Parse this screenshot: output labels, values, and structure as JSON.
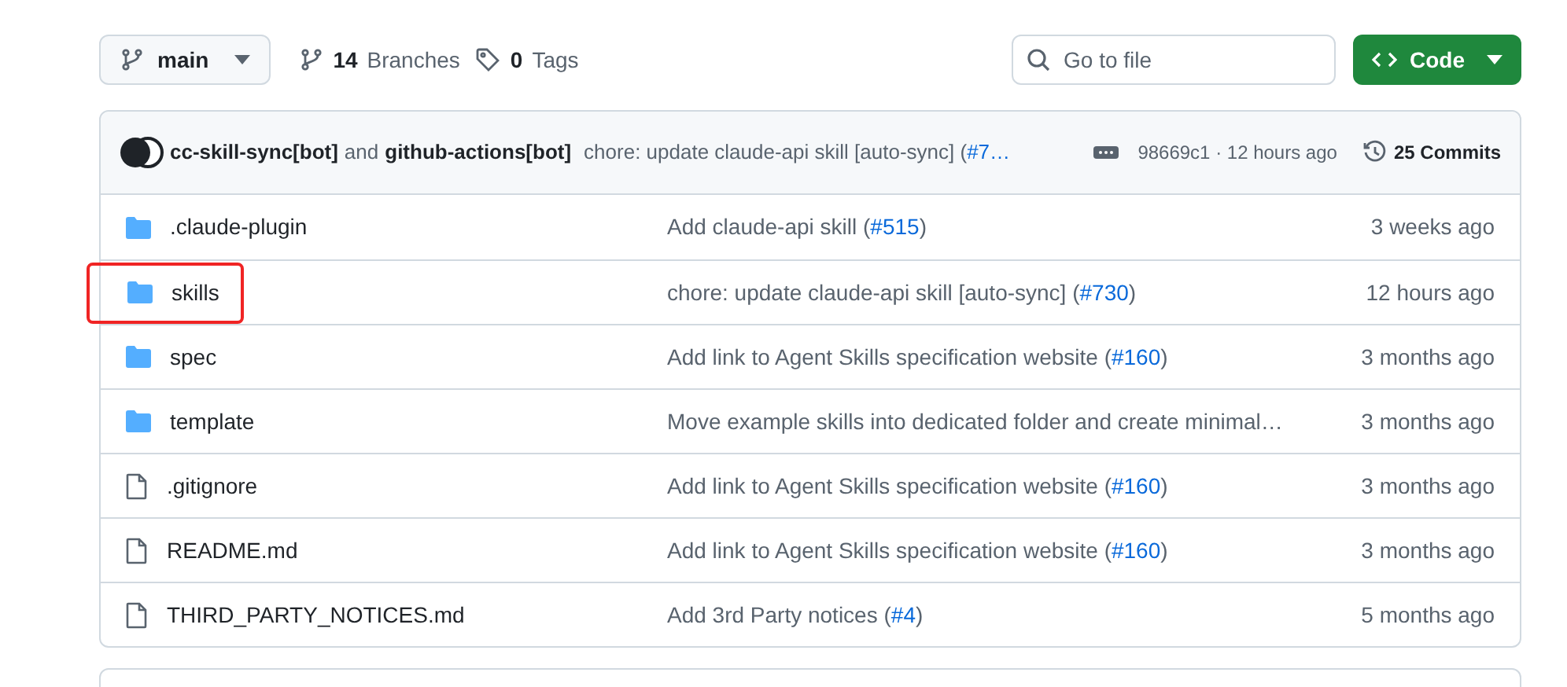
{
  "branch_button": {
    "label": "main"
  },
  "branches": {
    "count": "14",
    "label": "Branches"
  },
  "tags": {
    "count": "0",
    "label": "Tags"
  },
  "search": {
    "placeholder": "Go to file"
  },
  "code_button": {
    "label": "Code"
  },
  "latest_commit": {
    "author_1": "cc-skill-sync[bot]",
    "joiner": "and",
    "author_2": "github-actions[bot]",
    "message": {
      "before": "chore: update claude-api skill [auto-sync] (",
      "link": "#7…"
    },
    "hash_time": "98669c1 · 12 hours ago",
    "commits_count": "25",
    "commits_label": "Commits"
  },
  "files": [
    {
      "kind": "folder",
      "name": ".claude-plugin",
      "highlighted": false,
      "message": {
        "before": "Add claude-api skill (",
        "link": "#515",
        "after": ")"
      },
      "time": "3 weeks ago"
    },
    {
      "kind": "folder",
      "name": "skills",
      "highlighted": true,
      "message": {
        "before": "chore: update claude-api skill [auto-sync] (",
        "link": "#730",
        "after": ")"
      },
      "time": "12 hours ago"
    },
    {
      "kind": "folder",
      "name": "spec",
      "highlighted": false,
      "message": {
        "before": "Add link to Agent Skills specification website (",
        "link": "#160",
        "after": ")"
      },
      "time": "3 months ago"
    },
    {
      "kind": "folder",
      "name": "template",
      "highlighted": false,
      "message": {
        "before": "Move example skills into dedicated folder and create minimal…"
      },
      "time": "3 months ago"
    },
    {
      "kind": "file",
      "name": ".gitignore",
      "highlighted": false,
      "message": {
        "before": "Add link to Agent Skills specification website (",
        "link": "#160",
        "after": ")"
      },
      "time": "3 months ago"
    },
    {
      "kind": "file",
      "name": "README.md",
      "highlighted": false,
      "message": {
        "before": "Add link to Agent Skills specification website (",
        "link": "#160",
        "after": ")"
      },
      "time": "3 months ago"
    },
    {
      "kind": "file",
      "name": "THIRD_PARTY_NOTICES.md",
      "highlighted": false,
      "message": {
        "before": "Add 3rd Party notices (",
        "link": "#4",
        "after": ")"
      },
      "time": "5 months ago"
    }
  ]
}
